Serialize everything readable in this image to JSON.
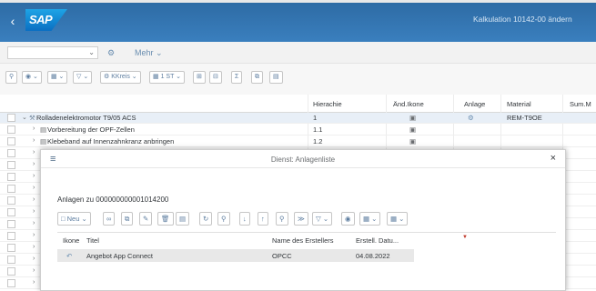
{
  "shell": {
    "back_icon": "chevron-left-icon",
    "logo_text": "SAP",
    "title": "Kalkulation 10142-00 ändern"
  },
  "subheader": {
    "variant_value": "",
    "settings_icon": "gear-icon",
    "more_label": "Mehr"
  },
  "toolbar": {
    "kkreis_label": "KKreis",
    "einheit_label": "1 ST"
  },
  "table": {
    "columns": [
      "Hierachie",
      "Änd.Ikone",
      "Anlage",
      "Material",
      "Sum.M"
    ],
    "rows": [
      {
        "text": "Rolladenelektromotor T9/05 ACS",
        "hier": "1",
        "material": "REM-T9OE"
      },
      {
        "text": "Vorbereitung der OPF-Zellen",
        "hier": "1.1",
        "material": ""
      },
      {
        "text": "Klebeband auf Innenzahnkranz anbringen",
        "hier": "1.2",
        "material": ""
      }
    ]
  },
  "dialog": {
    "title": "Dienst: Anlagenliste",
    "subtitle": "Anlagen zu 000000000001014200",
    "new_label": "Neu",
    "columns": {
      "icon": "Ikone",
      "title": "Titel",
      "creator": "Name des Erstellers",
      "date": "Erstell. Datu..."
    },
    "rows": [
      {
        "title": "Angebot App Connect",
        "creator": "OPCC",
        "date": "04.08.2022"
      }
    ]
  }
}
